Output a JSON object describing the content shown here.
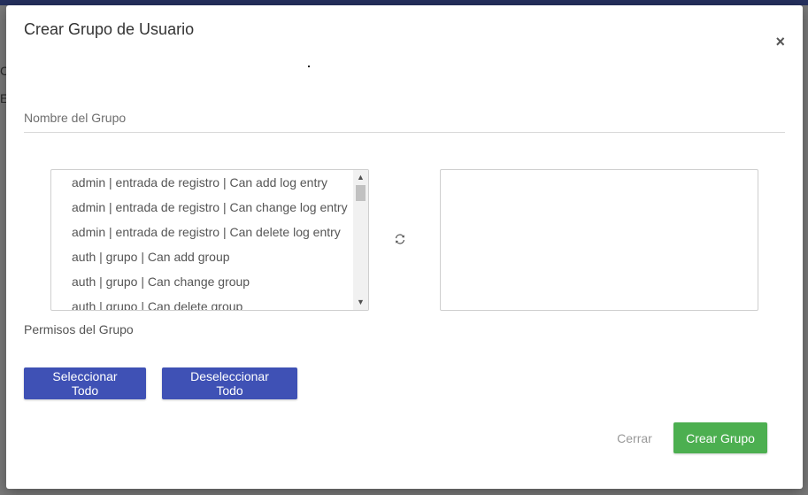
{
  "background": {
    "fragments": [
      "C",
      "E"
    ]
  },
  "modal": {
    "title": "Crear Grupo de Usuario",
    "close_icon": "×"
  },
  "form": {
    "group_name": {
      "placeholder": "Nombre del Grupo",
      "value": ""
    },
    "permissions": {
      "label": "Permisos del Grupo",
      "available": [
        "admin | entrada de registro | Can add log entry",
        "admin | entrada de registro | Can change log entry",
        "admin | entrada de registro | Can delete log entry",
        "auth | grupo | Can add group",
        "auth | grupo | Can change group",
        "auth | grupo | Can delete group"
      ],
      "selected": []
    },
    "select_all_label": "Seleccionar Todo",
    "deselect_all_label": "Deseleccionar Todo"
  },
  "footer": {
    "cancel_label": "Cerrar",
    "create_label": "Crear Grupo"
  },
  "colors": {
    "primary": "#3f51b5",
    "success": "#4caf50",
    "topbar": "#25305e"
  },
  "icons": {
    "refresh": "refresh-icon",
    "close": "close-icon",
    "scroll_up": "chevron-up-icon",
    "scroll_down": "chevron-down-icon"
  }
}
